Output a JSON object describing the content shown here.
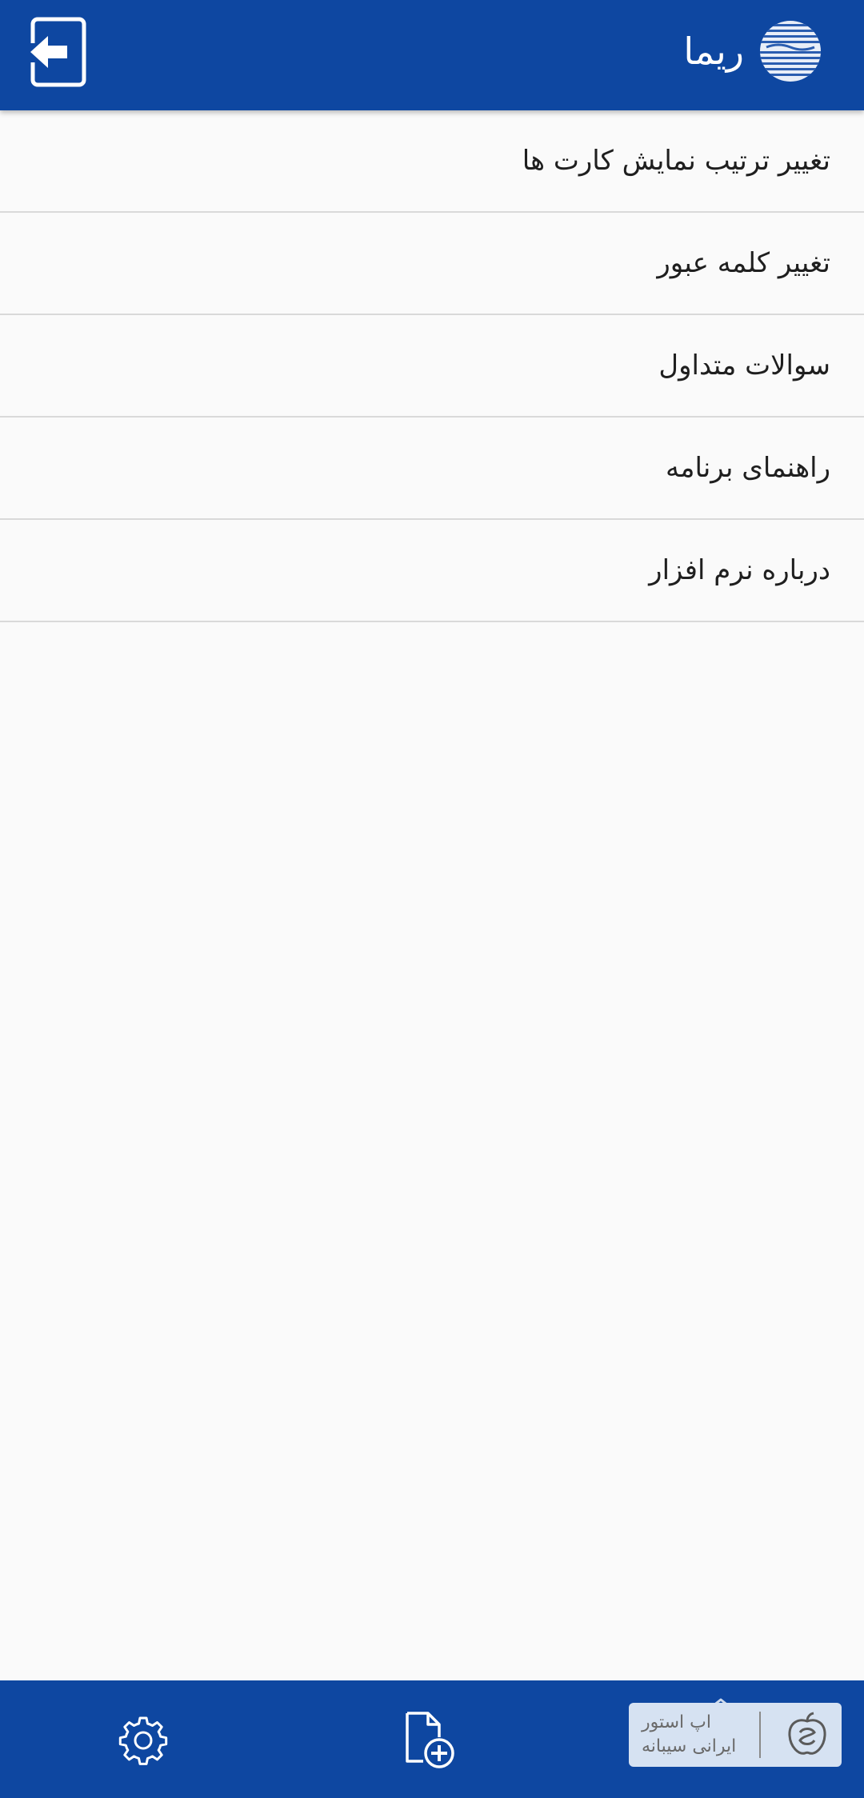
{
  "header": {
    "app_name": "ریما",
    "exit_icon": "exit-to-app-icon",
    "logo_icon": "rima-globe-logo"
  },
  "menu": {
    "items": [
      {
        "label": "تغییر ترتیب نمایش کارت ها"
      },
      {
        "label": "تغییر کلمه عبور"
      },
      {
        "label": "سوالات متداول"
      },
      {
        "label": "راهنمای برنامه"
      },
      {
        "label": "درباره نرم افزار"
      }
    ]
  },
  "bottom_nav": {
    "settings_icon": "gear-icon",
    "add_doc_icon": "add-document-icon",
    "store_badge": {
      "line1": "اپ استور",
      "line2": "ایرانی سیبانه",
      "icon": "sibapp-logo"
    }
  },
  "colors": {
    "primary": "#0e47a1",
    "background": "#fafafa",
    "divider": "#d9d9d9",
    "text": "#1f1f1f"
  }
}
